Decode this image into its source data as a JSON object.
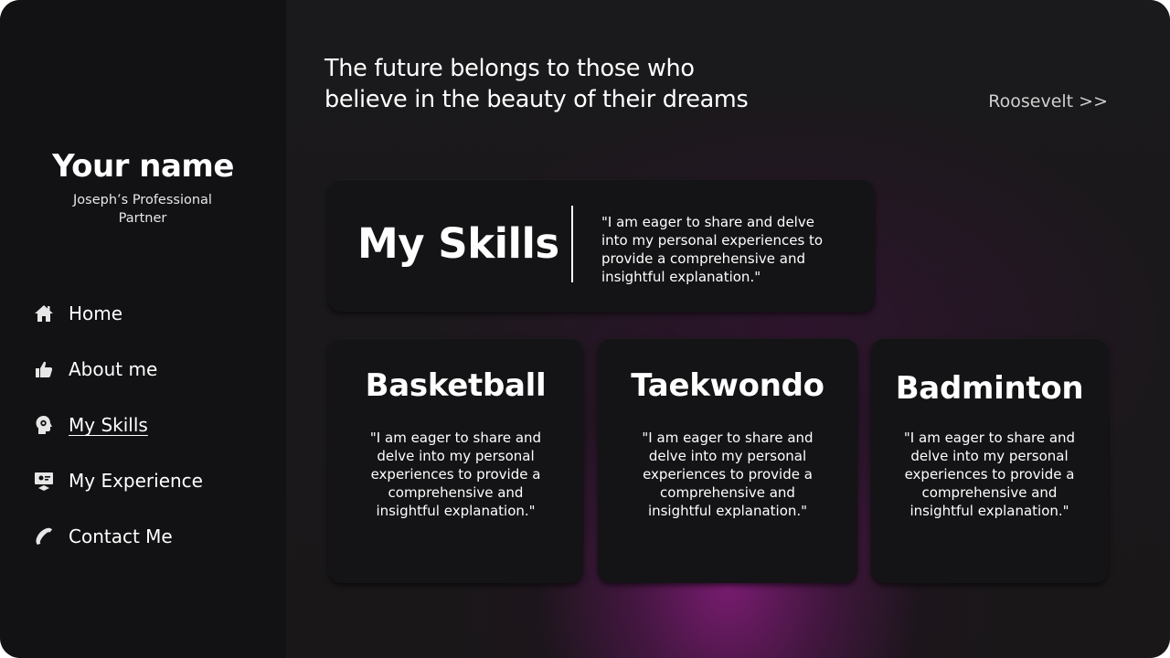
{
  "brand": {
    "name": "Your name",
    "subtitle": "Joseph’s Professional Partner"
  },
  "nav": {
    "items": [
      {
        "label": "Home",
        "icon": "home-icon"
      },
      {
        "label": "About me",
        "icon": "thumbs-up-icon"
      },
      {
        "label": "My Skills",
        "icon": "brain-gear-icon",
        "active": true
      },
      {
        "label": "My Experience",
        "icon": "graduate-board-icon"
      },
      {
        "label": "Contact Me",
        "icon": "phone-icon"
      }
    ]
  },
  "quote": {
    "line1": "The future belongs to those who",
    "line2": "believe in the beauty of their dreams",
    "author": "Roosevelt >>"
  },
  "hero": {
    "title": "My Skills",
    "text_lines": [
      "\"I am eager to share and delve",
      "into my personal experiences to",
      "provide a comprehensive and",
      "insightful explanation.\""
    ]
  },
  "skills": [
    {
      "title": "Basketball",
      "text_lines": [
        "\"I am eager to share and",
        "delve into my personal",
        "experiences to provide a",
        "comprehensive and",
        "insightful explanation.\""
      ]
    },
    {
      "title": "Taekwondo",
      "text_lines": [
        "\"I am eager to share and",
        "delve into my personal",
        "experiences to provide a",
        "comprehensive and",
        "insightful explanation.\""
      ]
    },
    {
      "title": "Badminton",
      "text_lines": [
        "\"I am eager to share and",
        "delve into my personal",
        "experiences to provide a",
        "comprehensive and",
        "insightful explanation.\""
      ]
    }
  ],
  "colors": {
    "background": "#151417",
    "sidebar": "#121113",
    "card": "#141315",
    "accent_glow": "#881c7e",
    "text": "#ffffff"
  }
}
